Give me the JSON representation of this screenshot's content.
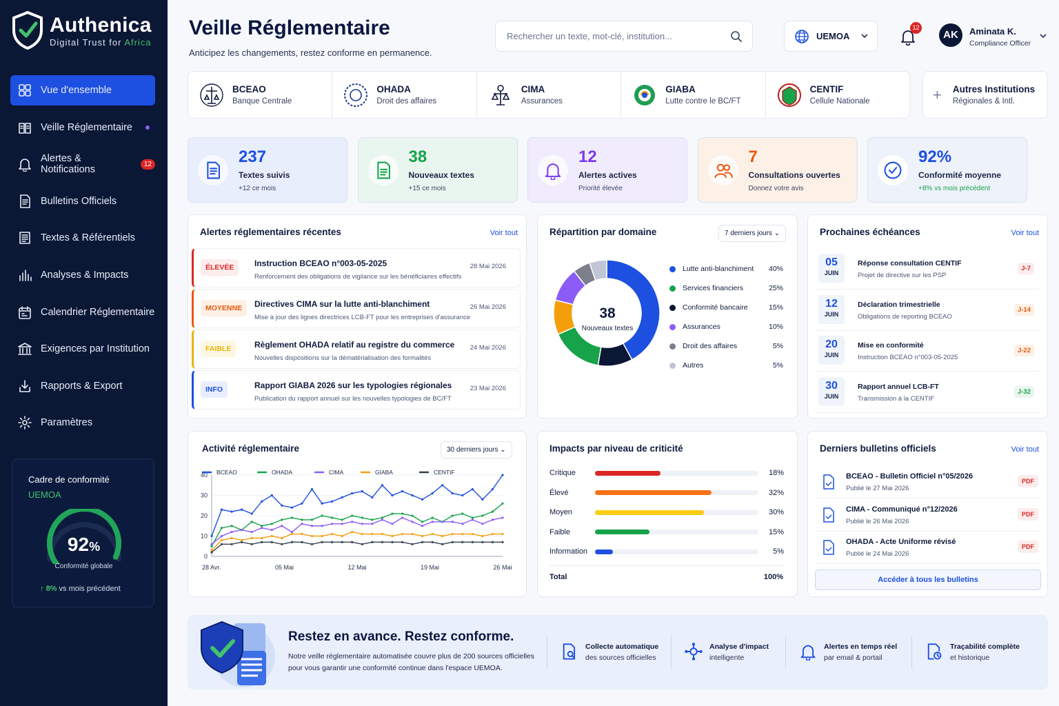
{
  "brand": {
    "name": "Authenica",
    "tagline_1": "Digital Trust for",
    "tagline_2": "Africa"
  },
  "nav": [
    {
      "label": "Vue d'ensemble",
      "icon": "grid-icon",
      "active": true
    },
    {
      "label": "Veille Réglementaire",
      "icon": "book-icon"
    },
    {
      "label": "Alertes & Notifications",
      "icon": "bell-icon",
      "badge": "12"
    },
    {
      "label": "Bulletins Officiels",
      "icon": "document-icon"
    },
    {
      "label": "Textes & Référentiels",
      "icon": "text-icon"
    },
    {
      "label": "Analyses & Impacts",
      "icon": "chart-bars-icon"
    },
    {
      "label": "Calendrier Réglementaire",
      "icon": "calendar-icon"
    },
    {
      "label": "Exigences par Institution",
      "icon": "bank-icon"
    },
    {
      "label": "Rapports & Export",
      "icon": "download-icon"
    },
    {
      "label": "Paramètres",
      "icon": "gear-icon"
    }
  ],
  "cadre": {
    "title": "Cadre de conformité",
    "region": "UEMOA",
    "value": "92",
    "unit": "%",
    "level": 0.92,
    "label": "Conformité globale",
    "delta": "8%",
    "delta_text": "vs mois précédent"
  },
  "header": {
    "title": "Veille Réglementaire",
    "subtitle": "Anticipez les changements, restez conforme en permanence.",
    "search_placeholder": "Rechercher un texte, mot-clé, institution...",
    "region": "UEMOA",
    "notif_count": "12",
    "user_initials": "AK",
    "user_name": "Aminata K.",
    "user_role": "Compliance Officer"
  },
  "institutions": [
    {
      "name": "BCEAO",
      "desc": "Banque Centrale"
    },
    {
      "name": "OHADA",
      "desc": "Droit des affaires"
    },
    {
      "name": "CIMA",
      "desc": "Assurances"
    },
    {
      "name": "GIABA",
      "desc": "Lutte contre le BC/FT"
    },
    {
      "name": "CENTIF",
      "desc": "Cellule Nationale"
    }
  ],
  "other_institutions": {
    "name": "Autres Institutions",
    "desc": "Régionales & Intl."
  },
  "kpis": [
    {
      "value": "237",
      "label": "Textes suivis",
      "sub": "+12 ce mois",
      "color": "#1d4fe0",
      "bg": "#e8eefc",
      "icon": "document-icon"
    },
    {
      "value": "38",
      "label": "Nouveaux textes",
      "sub": "+15 ce mois",
      "color": "#16a34a",
      "bg": "#e9f6ef",
      "icon": "file-text-icon"
    },
    {
      "value": "12",
      "label": "Alertes actives",
      "sub": "Priorité élevée",
      "color": "#7c3aed",
      "bg": "#f1ecfd",
      "icon": "bell-icon"
    },
    {
      "value": "7",
      "label": "Consultations ouvertes",
      "sub": "Donnez votre avis",
      "color": "#ea580c",
      "bg": "#fdf1e7",
      "icon": "users-icon"
    },
    {
      "value": "92%",
      "label": "Conformité moyenne",
      "sub": "+8% vs mois précédent",
      "color": "#1d4fe0",
      "bg": "#eef2fa",
      "icon": "check-circle-icon"
    }
  ],
  "alerts": {
    "title": "Alertes réglementaires récentes",
    "link": "Voir tout",
    "items": [
      {
        "level": "ÉLEVÉE",
        "title": "Instruction BCEAO n°003-05-2025",
        "desc": "Renforcement des obligations de vigilance sur les bénéficiaires effectifs",
        "date": "28 Mai 2026",
        "color": "#dc2626",
        "bg": "#fdecec"
      },
      {
        "level": "MOYENNE",
        "title": "Directives CIMA sur la lutte anti-blanchiment",
        "desc": "Mise à jour des lignes directrices LCB-FT pour les entreprises d'assurance",
        "date": "26 Mai 2026",
        "color": "#ea580c",
        "bg": "#fdf0e4"
      },
      {
        "level": "FAIBLE",
        "title": "Règlement OHADA relatif au registre du commerce",
        "desc": "Nouvelles dispositions sur la dématérialisation des formalités",
        "date": "24 Mai 2026",
        "color": "#eab308",
        "bg": "#fdf7e1"
      },
      {
        "level": "INFO",
        "title": "Rapport GIABA 2026 sur les typologies régionales",
        "desc": "Publication du rapport annuel sur les nouvelles typologies de BC/FT",
        "date": "23 Mai 2026",
        "color": "#1d4fe0",
        "bg": "#e8eefc"
      }
    ]
  },
  "repartition": {
    "title": "Répartition par domaine",
    "period": "7 derniers jours",
    "center_value": "38",
    "center_label": "Nouveaux textes"
  },
  "echeances": {
    "title": "Prochaines échéances",
    "link": "Voir tout",
    "items": [
      {
        "day": "05",
        "month": "JUIN",
        "title": "Réponse consultation CENTIF",
        "desc": "Projet de directive sur les PSP",
        "tag": "J-7",
        "color": "#dc2626",
        "bg": "#fdecec"
      },
      {
        "day": "12",
        "month": "JUIN",
        "title": "Déclaration trimestrielle",
        "desc": "Obligations de reporting BCEAO",
        "tag": "J-14",
        "color": "#ea580c",
        "bg": "#fdf0e4"
      },
      {
        "day": "20",
        "month": "JUIN",
        "title": "Mise en conformité",
        "desc": "Instruction BCEAO n°003-05-2025",
        "tag": "J-22",
        "color": "#ea580c",
        "bg": "#fdf0e4"
      },
      {
        "day": "30",
        "month": "JUIN",
        "title": "Rapport annuel LCB-FT",
        "desc": "Transmission à la CENTIF",
        "tag": "J-32",
        "color": "#16a34a",
        "bg": "#e9f6ef"
      }
    ]
  },
  "activite": {
    "title": "Activité réglementaire",
    "period": "30 derniers jours"
  },
  "impacts": {
    "title": "Impacts par niveau de criticité",
    "items": [
      {
        "label": "Critique",
        "value": 18,
        "text": "18%",
        "color": "#dc2626"
      },
      {
        "label": "Élevé",
        "value": 32,
        "text": "32%",
        "color": "#f97316"
      },
      {
        "label": "Moyen",
        "value": 30,
        "text": "30%",
        "color": "#facc15"
      },
      {
        "label": "Faible",
        "value": 15,
        "text": "15%",
        "color": "#16a34a"
      },
      {
        "label": "Information",
        "value": 5,
        "text": "5%",
        "color": "#1d4fe0"
      }
    ],
    "total_label": "Total",
    "total_value": "100%"
  },
  "bulletins": {
    "title": "Derniers bulletins officiels",
    "link": "Voir tout",
    "button": "Accéder à tous les bulletins",
    "items": [
      {
        "title": "BCEAO - Bulletin Officiel n°05/2026",
        "date": "Publié le 27 Mai 2026",
        "tag": "PDF"
      },
      {
        "title": "CIMA - Communiqué n°12/2026",
        "date": "Publié le 26 Mai 2026",
        "tag": "PDF"
      },
      {
        "title": "OHADA - Acte Uniforme révisé",
        "date": "Publié le 24 Mai 2026",
        "tag": "PDF"
      }
    ]
  },
  "banner": {
    "title": "Restez en avance. Restez conforme.",
    "desc": "Notre veille réglementaire automatisée couvre plus de 200 sources officielles pour vous garantir une conformité continue dans l'espace UEMOA.",
    "features": [
      {
        "title": "Collecte automatique",
        "desc": "des sources officielles",
        "icon": "document-search-icon"
      },
      {
        "title": "Analyse d'impact",
        "desc": "intelligente",
        "icon": "gear-network-icon"
      },
      {
        "title": "Alertes en temps réel",
        "desc": "par email & portail",
        "icon": "bell-icon"
      },
      {
        "title": "Traçabilité complète",
        "desc": "et historique",
        "icon": "document-clock-icon"
      }
    ]
  },
  "chart_data": [
    {
      "type": "pie",
      "title": "Répartition par domaine",
      "donut": true,
      "series": [
        {
          "name": "Lutte anti-blanchiment",
          "value": 40,
          "label": "40%",
          "color": "#1d4fe0"
        },
        {
          "name": "Services financiers",
          "value": 25,
          "label": "25%",
          "color": "#16a34a"
        },
        {
          "name": "Conformité bancaire",
          "value": 15,
          "label": "15%",
          "color": "#0a1735"
        },
        {
          "name": "Assurances",
          "value": 10,
          "label": "10%",
          "color": "#f59e0b"
        },
        {
          "name": "Droit des affaires",
          "value": 5,
          "label": "5%",
          "color": "#7c7f8c"
        },
        {
          "name": "Autres",
          "value": 5,
          "label": "5%",
          "color": "#c0c6d6"
        }
      ],
      "slice_order": [
        0,
        2,
        1,
        3,
        5,
        4
      ],
      "outer_color_override": {
        "3": "#8b5cf6"
      }
    },
    {
      "type": "line",
      "title": "Activité réglementaire",
      "x_ticks": [
        "28 Avr.",
        "05 Mai",
        "12 Mai",
        "19 Mai",
        "26 Mai"
      ],
      "ylim": [
        0,
        40
      ],
      "y_ticks": [
        0,
        10,
        20,
        30,
        40
      ],
      "legend_position": "top-left",
      "series": [
        {
          "name": "BCEAO",
          "color": "#1d4fe0",
          "values": [
            10,
            23,
            22,
            23,
            21,
            27,
            30,
            25,
            24,
            26,
            33,
            26,
            27,
            29,
            31,
            32,
            29,
            35,
            30,
            32,
            30,
            28,
            31,
            35,
            31,
            30,
            33,
            28,
            33,
            40
          ]
        },
        {
          "name": "OHADA",
          "color": "#16a34a",
          "values": [
            5,
            14,
            15,
            13,
            17,
            15,
            16,
            18,
            19,
            18,
            18,
            20,
            19,
            18,
            20,
            19,
            18,
            19,
            21,
            21,
            20,
            17,
            19,
            17,
            20,
            21,
            19,
            20,
            22,
            26
          ]
        },
        {
          "name": "CIMA",
          "color": "#8b5cf6",
          "values": [
            6,
            10,
            12,
            13,
            12,
            14,
            13,
            15,
            12,
            16,
            15,
            15,
            16,
            16,
            17,
            16,
            16,
            18,
            16,
            19,
            17,
            15,
            17,
            17,
            17,
            16,
            18,
            16,
            18,
            19
          ]
        },
        {
          "name": "GIABA",
          "color": "#f59e0b",
          "values": [
            3,
            8,
            9,
            8,
            9,
            9,
            10,
            9,
            11,
            11,
            10,
            10,
            11,
            10,
            12,
            11,
            11,
            11,
            10,
            11,
            11,
            10,
            11,
            10,
            11,
            11,
            11,
            10,
            11,
            11
          ]
        },
        {
          "name": "CENTIF",
          "color": "#374151",
          "values": [
            2,
            6,
            6,
            7,
            6,
            7,
            7,
            6,
            7,
            7,
            6,
            7,
            7,
            7,
            7,
            6,
            7,
            7,
            7,
            7,
            6,
            7,
            7,
            6,
            7,
            7,
            7,
            7,
            7,
            7
          ]
        }
      ]
    }
  ]
}
